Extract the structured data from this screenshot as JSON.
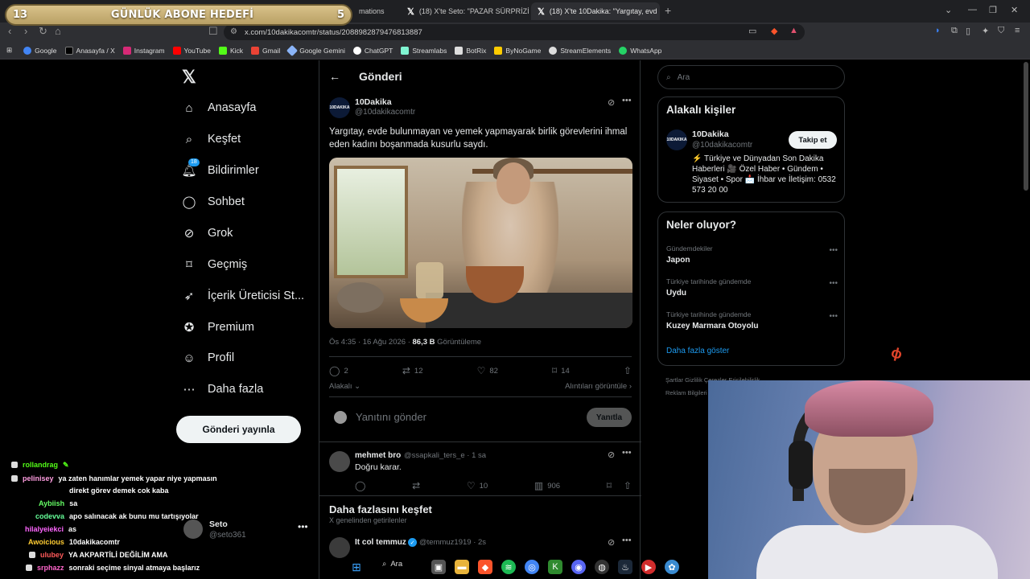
{
  "stream_goal": {
    "left": "13",
    "title": "GÜNLÜK ABONE HEDEFİ",
    "right": "5"
  },
  "tabs": [
    {
      "label": "mations"
    },
    {
      "label": "(18) X'te Seto: \"PAZAR SÜRPRİZİ htt"
    },
    {
      "label": "(18) X'te 10Dakika: \"Yargıtay, evd"
    }
  ],
  "address_bar": {
    "url": "x.com/10dakikacomtr/status/2088982879476813887"
  },
  "bookmarks": [
    {
      "label": "Google",
      "color": "#4285f4"
    },
    {
      "label": "Anasayfa / X",
      "color": "#000000"
    },
    {
      "label": "Instagram",
      "color": "#d62976"
    },
    {
      "label": "YouTube",
      "color": "#ff0000"
    },
    {
      "label": "Kick",
      "color": "#53fc18"
    },
    {
      "label": "Gmail",
      "color": "#ea4335"
    },
    {
      "label": "Google Gemini",
      "color": "#8ab4f8"
    },
    {
      "label": "ChatGPT",
      "color": "#ffffff"
    },
    {
      "label": "Streamlabs",
      "color": "#80f5d2"
    },
    {
      "label": "BotRix",
      "color": "#ffffff"
    },
    {
      "label": "ByNoGame",
      "color": "#ffcc00"
    },
    {
      "label": "StreamElements",
      "color": "#ffffff"
    },
    {
      "label": "WhatsApp",
      "color": "#25d366"
    }
  ],
  "sidenav": {
    "items": [
      {
        "label": "Anasayfa",
        "icon": "home-icon"
      },
      {
        "label": "Keşfet",
        "icon": "search-icon"
      },
      {
        "label": "Bildirimler",
        "icon": "bell-icon",
        "badge": "18"
      },
      {
        "label": "Sohbet",
        "icon": "chat-icon"
      },
      {
        "label": "Grok",
        "icon": "grok-icon"
      },
      {
        "label": "Geçmiş",
        "icon": "bookmark-icon"
      },
      {
        "label": "İçerik Üreticisi St...",
        "icon": "rocket-icon"
      },
      {
        "label": "Premium",
        "icon": "verified-icon"
      },
      {
        "label": "Profil",
        "icon": "person-icon"
      },
      {
        "label": "Daha fazla",
        "icon": "more-circle-icon"
      }
    ],
    "post_button": "Gönderi yayınla",
    "account": {
      "name": "Seto",
      "handle": "@seto361"
    }
  },
  "post": {
    "header_title": "Gönderi",
    "author_name": "10Dakika",
    "author_handle": "@10dakikacomtr",
    "avatar_text": "10DAKIKA",
    "text": "Yargıtay, evde bulunmayan ve yemek yapmayarak birlik görevlerini ihmal eden kadını boşanmada kusurlu saydı.",
    "time": "Ös 4:35 · 16 Ağu 2026 · ",
    "views": "86,3 B",
    "views_label": " Görüntüleme",
    "replies": "2",
    "reposts": "12",
    "likes": "82",
    "bookmarks": "14",
    "relevance": "Alakalı",
    "quotes_link": "Alıntıları görüntüle"
  },
  "composer": {
    "placeholder": "Yanıtını gönder",
    "button": "Yanıtla"
  },
  "comment": {
    "name": "mehmet bro",
    "handle": "@ssapkali_ters_e · 1 sa",
    "text": "Doğru karar.",
    "likes": "10",
    "views": "906"
  },
  "discover": {
    "title": "Daha fazlasını keşfet",
    "subtitle": "X genelinden getirilenler",
    "first_name": "It col temmuz",
    "first_handle": "@temmuz1919 · 2s"
  },
  "right": {
    "search_placeholder": "Ara",
    "relevant_title": "Alakalı kişiler",
    "person_name": "10Dakika",
    "person_handle": "@10dakikacomtr",
    "follow": "Takip et",
    "bio": "⚡ Türkiye ve Dünyadan Son Dakika Haberleri 🎥 Özel Haber • Gündem • Siyaset • Spor 📩 İhbar ve İletişim: 0532 573 20 00",
    "trends_title": "Neler oluyor?",
    "trends": [
      {
        "context": "Gündemdekiler",
        "topic": "Japon"
      },
      {
        "context": "Türkiye tarihinde gündemde",
        "topic": "Uydu"
      },
      {
        "context": "Türkiye tarihinde gündemde",
        "topic": "Kuzey Marmara Otoyolu"
      }
    ],
    "show_more": "Daha fazla göster",
    "footer1": "Şartlar   Gizlilik   Çerezler   Erişilebilirlik",
    "footer2": "Reklam Bilgileri"
  },
  "chat": [
    {
      "user": "rollandrag",
      "color": "#53fc18",
      "msg": ""
    },
    {
      "user": "pelinisey",
      "color": "#ff9de0",
      "msg": "ya zaten hanımlar yemek yapar niye yapmasın"
    },
    {
      "user": "",
      "color": "#ffffff",
      "msg": "direkt görev demek cok kaba"
    },
    {
      "user": "Aybiish",
      "color": "#66ff66",
      "msg": "sa"
    },
    {
      "user": "codevva",
      "color": "#66ff99",
      "msg": "apo salınacak ak bunu mu tartışıyolar"
    },
    {
      "user": "hilalyeiekci",
      "color": "#ff66ff",
      "msg": "as"
    },
    {
      "user": "Awoicious",
      "color": "#ffcc33",
      "msg": "10dakikacomtr"
    },
    {
      "user": "ulubey",
      "color": "#ff5a5a",
      "msg": "YA AKPARTİLİ DEĞİLİM AMA"
    },
    {
      "user": "srphazz",
      "color": "#ff66cc",
      "msg": "sonraki seçime sinyal atmaya başlarız"
    }
  ],
  "taskbar": {
    "search": "Ara"
  }
}
